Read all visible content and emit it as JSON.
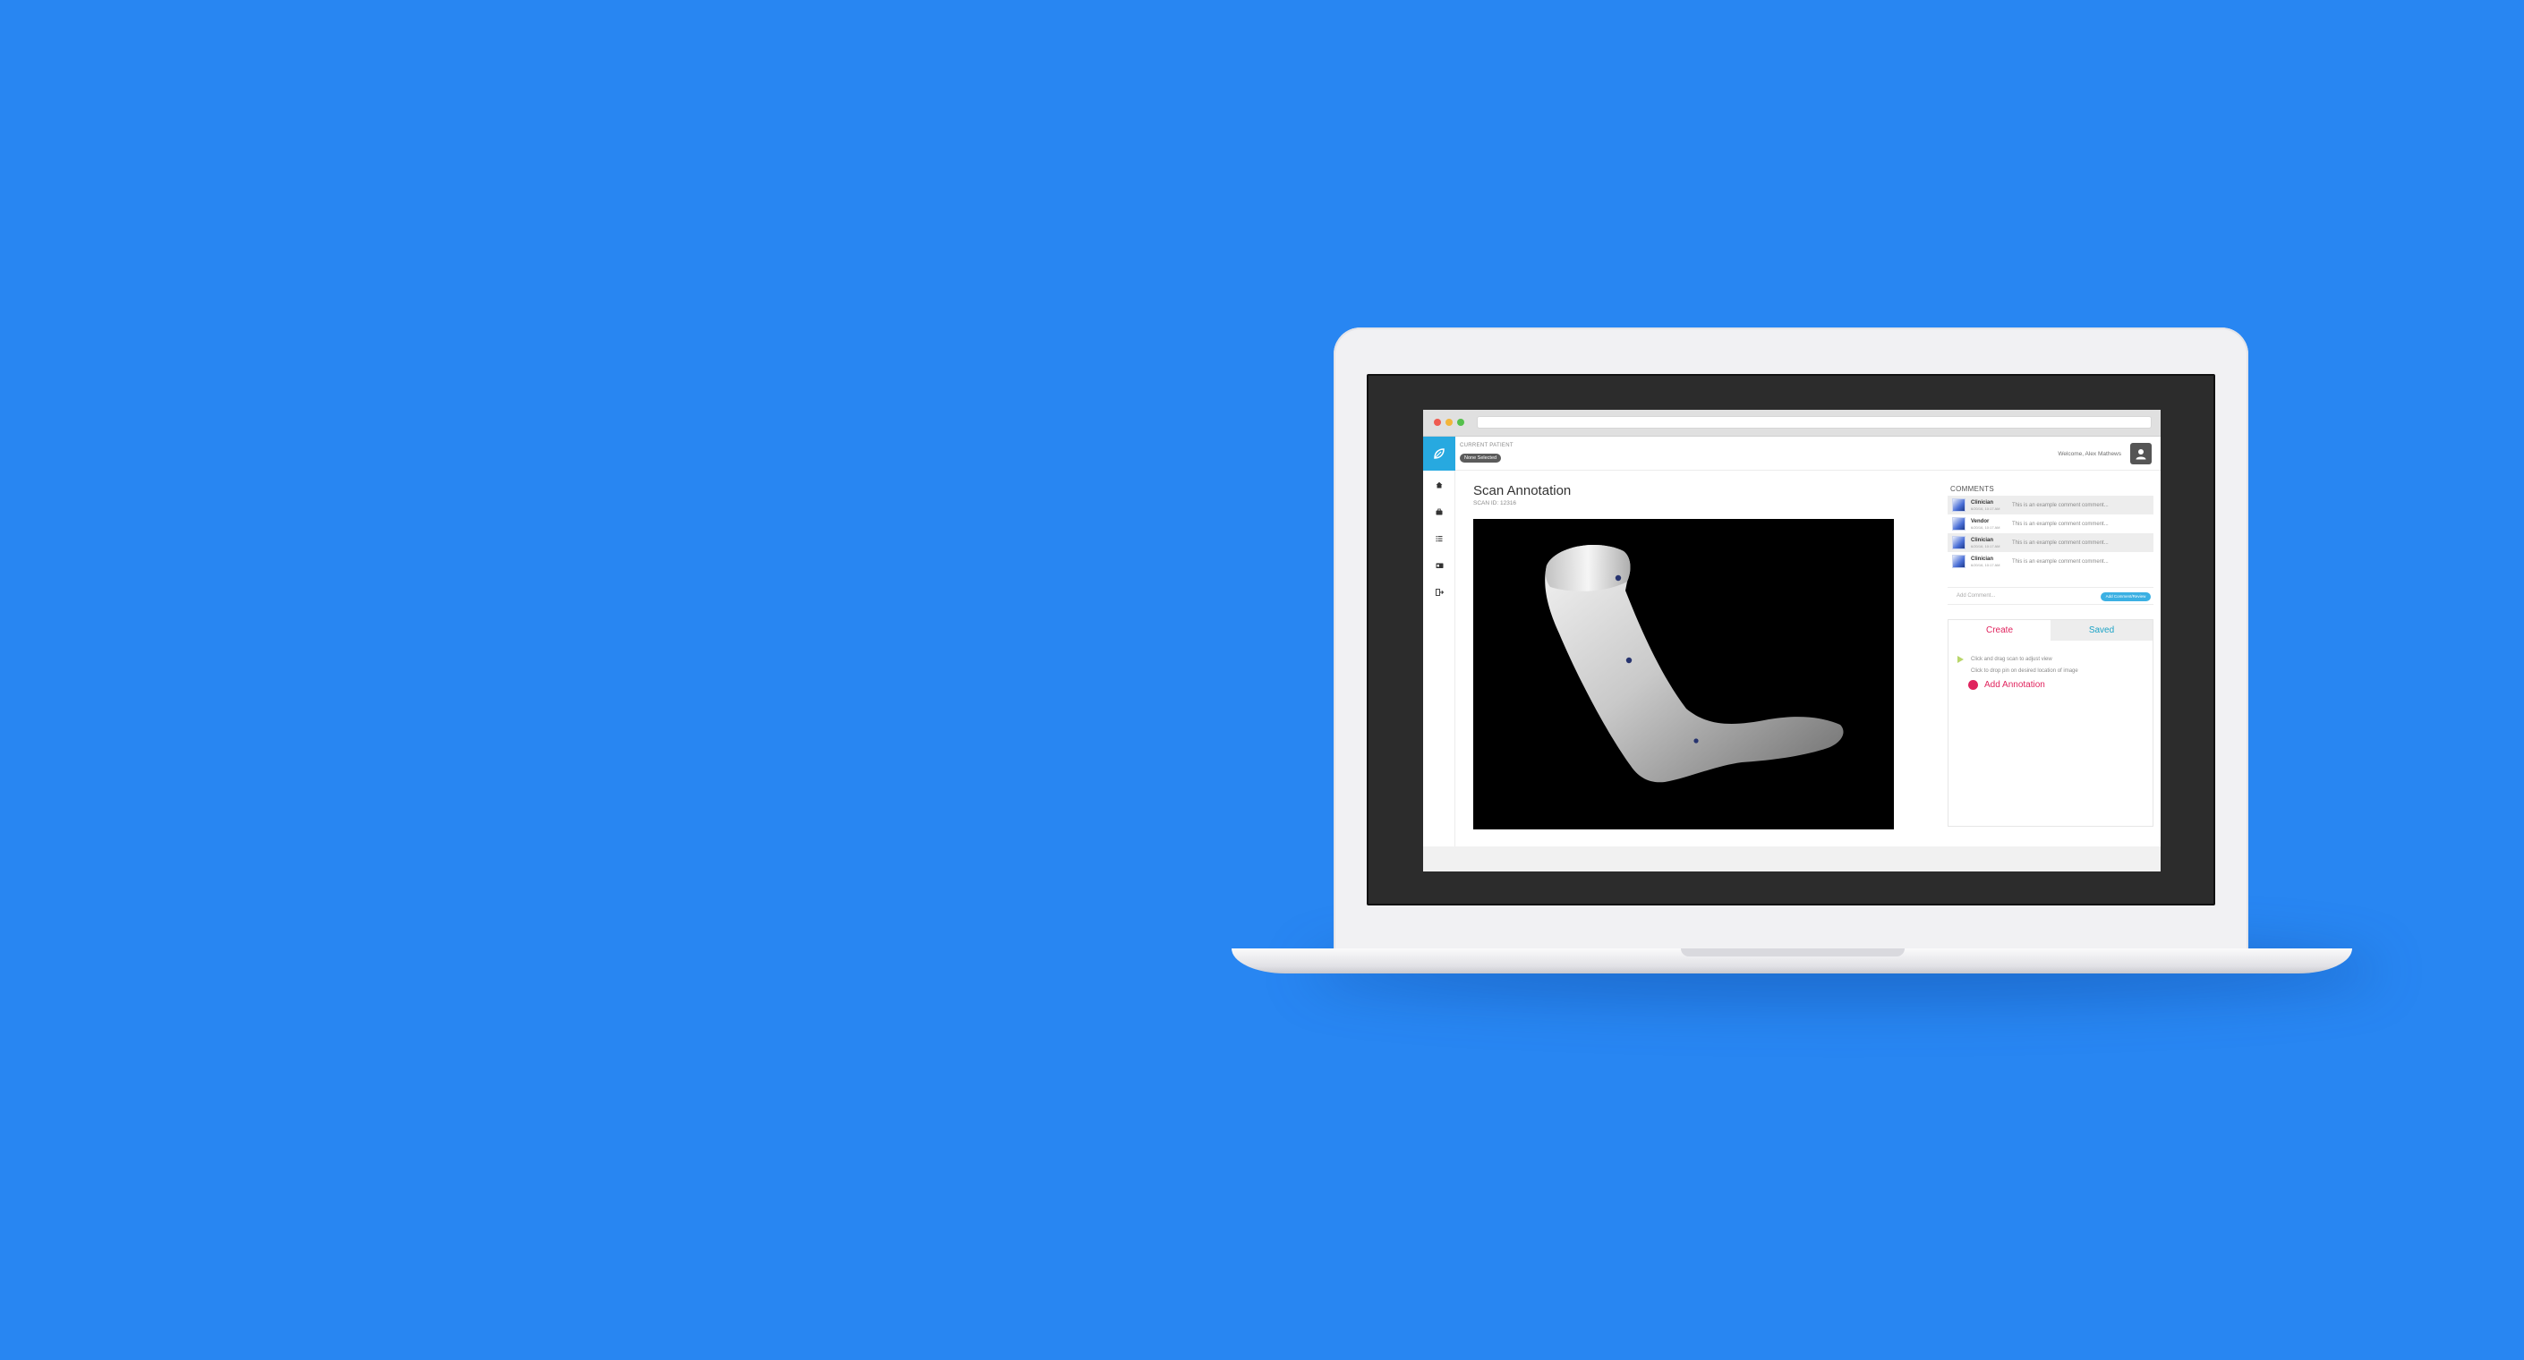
{
  "header": {
    "patient_label": "CURRENT PATIENT",
    "patient_value": "None Selected",
    "welcome": "Welcome, Alex Mathews"
  },
  "nav": {
    "items": [
      "home-icon",
      "briefcase-icon",
      "list-icon",
      "card-icon",
      "logout-icon"
    ]
  },
  "main": {
    "title": "Scan Annotation",
    "scan_id": "SCAN ID: 12316"
  },
  "comments": {
    "label": "COMMENTS",
    "items": [
      {
        "author": "Clinician",
        "date": "6/20/16, 10:17 AM",
        "text": "This is an example comment comment..."
      },
      {
        "author": "Vendor",
        "date": "6/20/16, 10:17 AM",
        "text": "This is an example comment comment..."
      },
      {
        "author": "Clinician",
        "date": "6/20/16, 10:17 AM",
        "text": "This is an example comment comment..."
      },
      {
        "author": "Clinician",
        "date": "6/20/16, 10:17 AM",
        "text": "This is an example comment comment..."
      }
    ],
    "add_placeholder": "Add Comment...",
    "send_label": "Add Comment/Review"
  },
  "annotation": {
    "tab_create": "Create",
    "tab_saved": "Saved",
    "step1": "Click and drag scan to adjust view",
    "step2": "Click to drop pin on desired location of image",
    "add_label": "Add Annotation"
  },
  "colors": {
    "background": "#2886f2",
    "accent_blue": "#27a9e0",
    "accent_pink": "#e0245e",
    "accent_teal": "#1ba3c6"
  }
}
